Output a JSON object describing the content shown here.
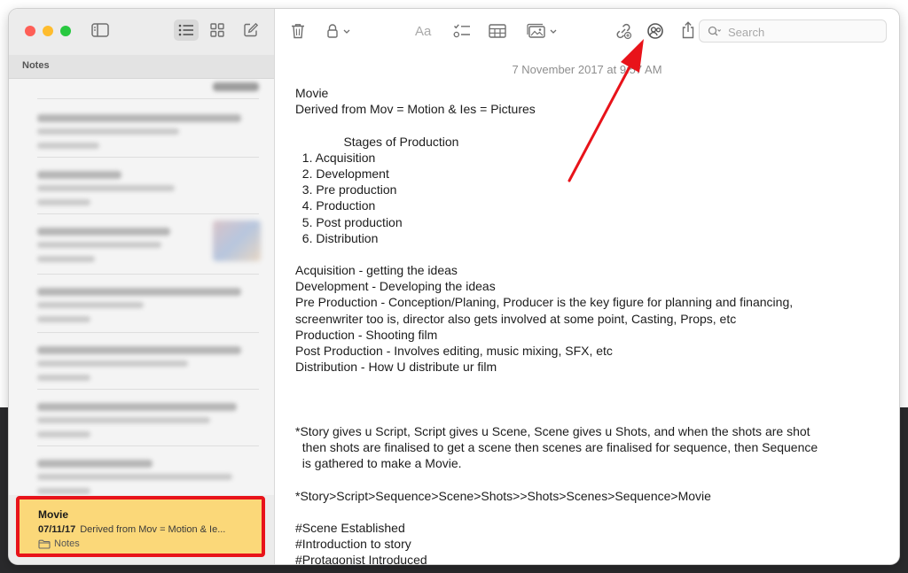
{
  "sidebar": {
    "section_title": "Notes",
    "selected_note": {
      "title": "Movie",
      "date": "07/11/17",
      "preview": "Derived from Mov = Motion & Ie...",
      "folder": "Notes"
    }
  },
  "toolbar": {
    "search_placeholder": "Search"
  },
  "note": {
    "date": "7 November 2017 at 9:57 AM",
    "lines": [
      "Movie",
      "Derived from Mov = Motion & Ies = Pictures",
      "",
      "              Stages of Production",
      "  1. Acquisition",
      "  2. Development",
      "  3. Pre production",
      "  4. Production",
      "  5. Post production",
      "  6. Distribution",
      "",
      "Acquisition - getting the ideas",
      "Development - Developing the ideas",
      "Pre Production - Conception/Planing, Producer is the key figure for planning and financing,",
      "screenwriter too is, director also gets involved at some point, Casting, Props, etc",
      "Production - Shooting film",
      "Post Production - Involves editing, music mixing, SFX, etc",
      "Distribution - How U distribute ur film",
      "",
      "",
      "",
      "*Story gives u Script, Script gives u Scene, Scene gives u Shots, and when the shots are shot",
      "  then shots are finalised to get a scene then scenes are finalised for sequence, then Sequence",
      "  is gathered to make a Movie.",
      "",
      "*Story>Script>Sequence>Scene>Shots>>Shots>Scenes>Sequence>Movie",
      "",
      "#Scene Established",
      "#Introduction to story",
      "#Protagonist Introduced"
    ]
  },
  "colors": {
    "highlight_border": "#e8131a",
    "selected_note_bg": "#fbd879",
    "arrow": "#e8131a"
  }
}
